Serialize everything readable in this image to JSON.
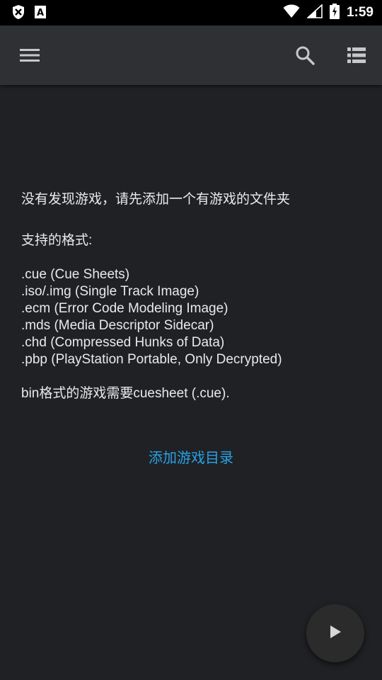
{
  "statusbar": {
    "time": "1:59",
    "icons": [
      "vpn-shield-icon",
      "font-a-icon",
      "wifi-icon",
      "signal-icon",
      "battery-charging-icon"
    ]
  },
  "appbar": {
    "menu_icon": "hamburger-menu-icon",
    "search_icon": "search-icon",
    "view_icon": "list-view-icon"
  },
  "content": {
    "empty_message": "没有发现游戏，请先添加一个有游戏的文件夹",
    "formats_title": "支持的格式:",
    "formats": [
      ".cue (Cue Sheets)",
      ".iso/.img (Single Track Image)",
      ".ecm (Error Code Modeling Image)",
      ".mds (Media Descriptor Sidecar)",
      ".chd (Compressed Hunks of Data)",
      ".pbp (PlayStation Portable, Only Decrypted)"
    ],
    "bin_note": "bin格式的游戏需要cuesheet (.cue).",
    "add_directory_link": "添加游戏目录"
  },
  "fab": {
    "icon": "play-icon"
  },
  "colors": {
    "background": "#202124",
    "appbar": "#2e3033",
    "link": "#27a2e6",
    "text": "#e8eaed"
  }
}
